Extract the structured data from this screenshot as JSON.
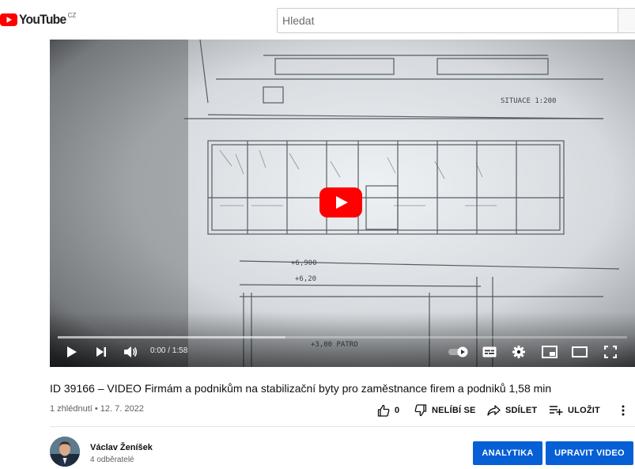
{
  "header": {
    "logo_text": "YouTube",
    "country_code": "CZ",
    "search_placeholder": "Hledat"
  },
  "player": {
    "time": "0:00 / 1:58",
    "progress": 0.0,
    "buffered": 0.4
  },
  "video": {
    "title": "ID 39166 – VIDEO Firmám a podnikům na stabilizační byty pro zaměstnance firem a podniků 1,58 min",
    "meta": "1 zhlédnutí • 12. 7. 2022"
  },
  "actions": {
    "like_count": "0",
    "dislike_label": "NELÍBÍ SE",
    "share_label": "SDÍLET",
    "save_label": "ULOŽIT"
  },
  "channel": {
    "name": "Václav Ženíšek",
    "subscribers": "4 odběratelé"
  },
  "buttons": {
    "analytics": "ANALYTIKA",
    "edit_video": "UPRAVIT VIDEO"
  },
  "colors": {
    "brand_red": "#ff0000",
    "button_blue": "#065fd4"
  }
}
